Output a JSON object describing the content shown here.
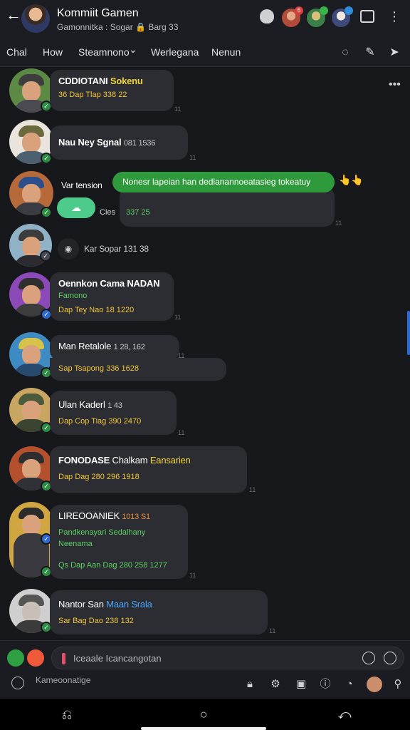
{
  "header": {
    "back_icon": "arrow-left-icon",
    "title": "Kommiit Gamen",
    "subtitle": "Gamonnitka : Sogar 🔒 Barg 33",
    "icons": [
      "shield-icon",
      "avatar-notification",
      "avatar-online",
      "avatar-profile",
      "window-icon",
      "more-vert-icon"
    ],
    "badge_count": "6"
  },
  "tabs": {
    "items": [
      "Chal",
      "How",
      "Steamnono",
      "Werlegana",
      "Nenun"
    ],
    "dropdown_caret": "⌄",
    "right_icons": [
      "mute-icon",
      "pin-icon",
      "share-icon"
    ]
  },
  "messages": [
    {
      "name": "CDDIOTANI",
      "name_tag": "Sokenu",
      "line": "36 Dap Tlap 338 22",
      "tick": "11"
    },
    {
      "name": "Nau Ney Sgnal",
      "meta": "081 1536",
      "tick": "11"
    },
    {
      "name": "Var tension",
      "green_message": "Nonesr lapeian han dedlanannoeatasieg tokeatuy",
      "reaction": "👆👆",
      "reply_meta": "Cies",
      "reply_line": "337 25",
      "tick": "11"
    },
    {
      "name": "Kar Sopar",
      "meta": "131 38"
    },
    {
      "name": "Oennkon Cama NADAN",
      "tag": "Famono",
      "line": "Dap Tey Nao 18 1220",
      "tick": "11"
    },
    {
      "name": "Man Retalole",
      "meta": "1 28, 162",
      "line": "Sap Tsapong 336 1628",
      "tick": "11"
    },
    {
      "name": "Ulan Kaderl",
      "meta": "1 43",
      "line": "Dap Cop Tiag 390 2470",
      "tick": "11"
    },
    {
      "name": "FONODASE",
      "name_tag": "Chalkam",
      "name_tag2": "Eansarien",
      "line": "Dap Dag 280 296 1918",
      "tick": "11"
    },
    {
      "name": "LIREOOANIEK",
      "meta": "1013 S1",
      "green_line": "Pandkenayari Sedalhany",
      "green_line2": "Neenama",
      "line": "Qs Dap Aan Dag 280 258 1277",
      "tick": "11"
    },
    {
      "name": "Nantor San",
      "name_tag": "Maan Srala",
      "line": "Sar Bag Dao 238 132",
      "tick": "11"
    }
  ],
  "composer": {
    "placeholder": "Iceaale Icancangotan",
    "search_placeholder": "Kameoonatige",
    "tools": [
      "lock-icon",
      "gear-icon",
      "box-icon",
      "info-icon",
      "timer-icon",
      "avatar-icon",
      "pin-icon"
    ]
  },
  "colors": {
    "accent_green": "#2f9a3c",
    "accent_yellow": "#f2d33b",
    "accent_blue": "#2f6ad1",
    "bubble": "#2c2d33",
    "background": "#17181c"
  }
}
